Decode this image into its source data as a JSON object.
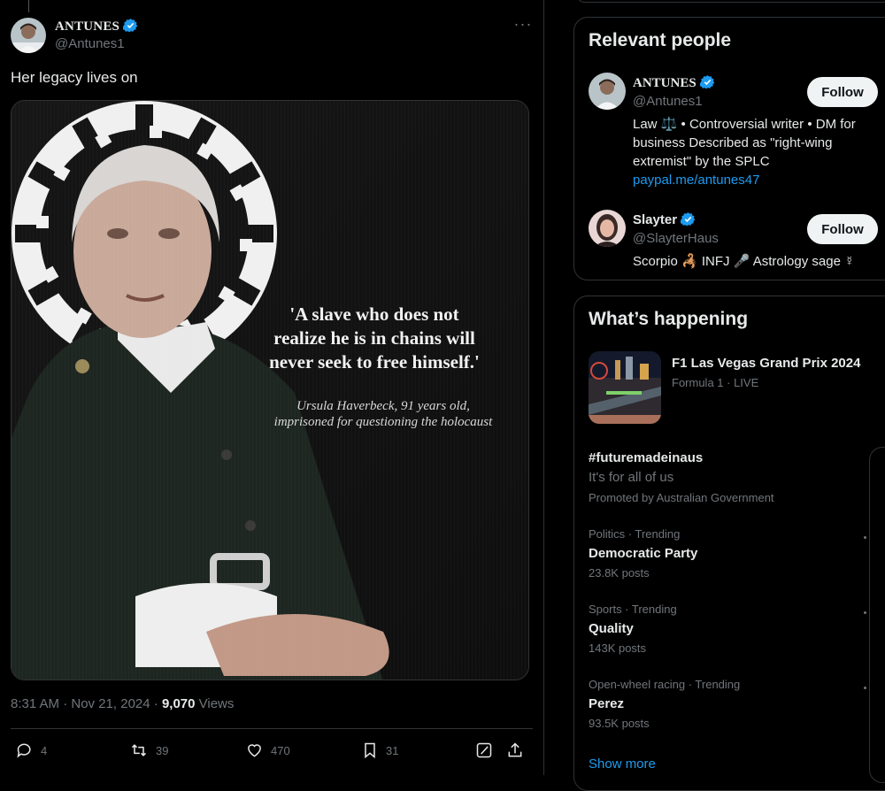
{
  "tweet": {
    "author_name": "ANTUNES",
    "author_handle": "@Antunes1",
    "text": "Her legacy lives on",
    "more_label": "···",
    "image": {
      "quote_lines": [
        "'A slave who does not",
        "realize he is in chains will",
        "never seek to free himself.'"
      ],
      "caption_lines": [
        "Ursula Haverbeck, 91 years old,",
        "imprisoned for questioning the holocaust"
      ]
    },
    "meta": {
      "time": "8:31 AM · Nov 21, 2024 · ",
      "views_count": "9,070",
      "views_label": " Views"
    },
    "actions": {
      "replies": "4",
      "reposts": "39",
      "likes": "470",
      "bookmarks": "31"
    }
  },
  "relevant_people": {
    "title": "Relevant people",
    "people": [
      {
        "name": "ANTUNES",
        "handle": "@Antunes1",
        "bio": "Law ⚖️ • Controversial writer • DM for business Described as \"right-wing extremist\" by the SPLC",
        "link": "paypal.me/antunes47",
        "follow_label": "Follow"
      },
      {
        "name": "Slayter",
        "handle": "@SlayterHaus",
        "bio": "Scorpio 🦂 INFJ 🎤 Astrology sage ☿",
        "follow_label": "Follow"
      }
    ]
  },
  "whats_happening": {
    "title": "What’s happening",
    "items": [
      {
        "title": "F1 Las Vegas Grand Prix 2024",
        "sub": "Formula 1 · LIVE"
      },
      {
        "title": "#futuremadeinaus",
        "text": "It's for all of us",
        "sub": "Promoted by Australian Government"
      },
      {
        "context": "Politics · Trending",
        "title": "Democratic Party",
        "posts": "23.8K posts"
      },
      {
        "context": "Sports · Trending",
        "title": "Quality",
        "posts": "143K posts"
      },
      {
        "context": "Open-wheel racing · Trending",
        "title": "Perez",
        "posts": "93.5K posts"
      }
    ],
    "show_more": "Show more"
  },
  "colors": {
    "accent": "#1d9bf0",
    "text": "#e7e9ea",
    "muted": "#71767b",
    "border": "#2f3336"
  }
}
